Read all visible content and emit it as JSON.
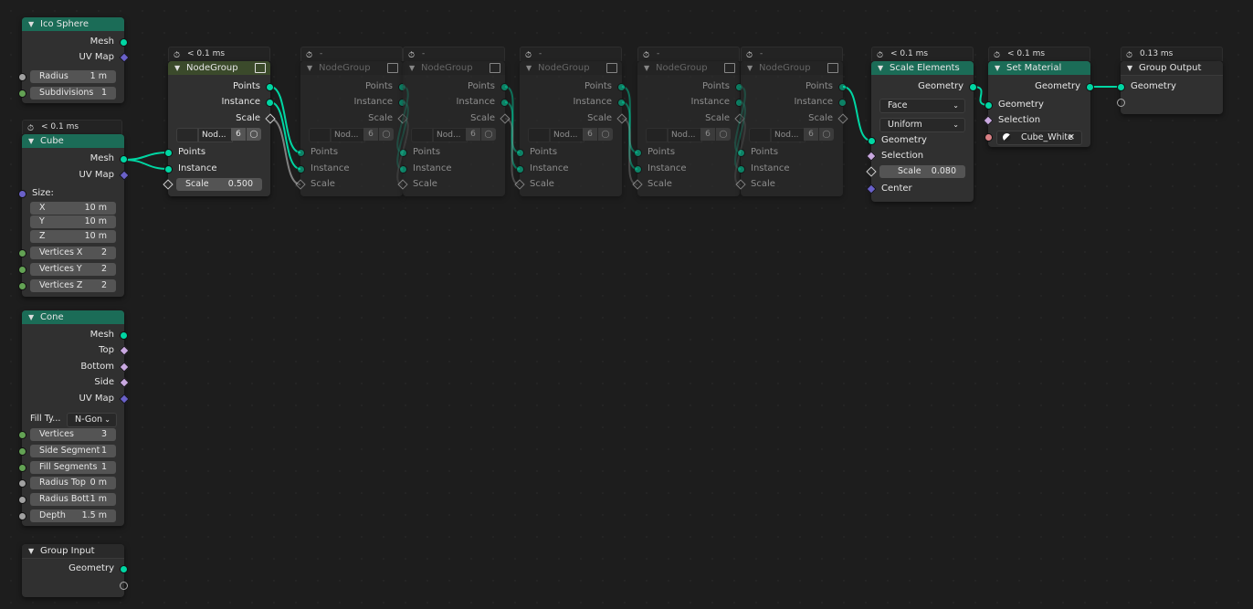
{
  "nodes": {
    "ico_sphere": {
      "title": "Ico Sphere",
      "outputs": [
        "Mesh",
        "UV Map"
      ],
      "fields": [
        {
          "label": "Radius",
          "value": "1 m"
        },
        {
          "label": "Subdivisions",
          "value": "1"
        }
      ]
    },
    "cube": {
      "timer": "< 0.1 ms",
      "title": "Cube",
      "outputs": [
        "Mesh",
        "UV Map"
      ],
      "size_label": "Size:",
      "fields": [
        {
          "label": "X",
          "value": "10 m"
        },
        {
          "label": "Y",
          "value": "10 m"
        },
        {
          "label": "Z",
          "value": "10 m"
        },
        {
          "label": "Vertices X",
          "value": "2"
        },
        {
          "label": "Vertices Y",
          "value": "2"
        },
        {
          "label": "Vertices Z",
          "value": "2"
        }
      ]
    },
    "cone": {
      "title": "Cone",
      "outputs": [
        "Mesh",
        "Top",
        "Bottom",
        "Side",
        "UV Map"
      ],
      "fill_type_label": "Fill Ty...",
      "fill_type_value": "N-Gon",
      "fields": [
        {
          "label": "Vertices",
          "value": "3"
        },
        {
          "label": "Side Segment",
          "value": "1"
        },
        {
          "label": "Fill Segments",
          "value": "1"
        },
        {
          "label": "Radius Top",
          "value": "0 m"
        },
        {
          "label": "Radius Bott",
          "value": "1 m"
        },
        {
          "label": "Depth",
          "value": "1.5 m"
        }
      ]
    },
    "group_input": {
      "title": "Group Input",
      "outputs": [
        "Geometry"
      ]
    },
    "node_groups": [
      {
        "timer": "< 0.1 ms",
        "title": "NodeGroup",
        "outputs": [
          "Points",
          "Instance",
          "Scale"
        ],
        "group_name": "Nod...",
        "users": "6",
        "inputs": [
          "Points",
          "Instance"
        ],
        "scale_label": "Scale",
        "scale_value": "0.500"
      },
      {
        "timer": "-",
        "title": "NodeGroup",
        "outputs": [
          "Points",
          "Instance",
          "Scale"
        ],
        "group_name": "Nod...",
        "users": "6",
        "inputs": [
          "Points",
          "Instance",
          "Scale"
        ]
      },
      {
        "timer": "-",
        "title": "NodeGroup",
        "outputs": [
          "Points",
          "Instance",
          "Scale"
        ],
        "group_name": "Nod...",
        "users": "6",
        "inputs": [
          "Points",
          "Instance",
          "Scale"
        ]
      },
      {
        "timer": "-",
        "title": "NodeGroup",
        "outputs": [
          "Points",
          "Instance",
          "Scale"
        ],
        "group_name": "Nod...",
        "users": "6",
        "inputs": [
          "Points",
          "Instance",
          "Scale"
        ]
      },
      {
        "timer": "-",
        "title": "NodeGroup",
        "outputs": [
          "Points",
          "Instance",
          "Scale"
        ],
        "group_name": "Nod...",
        "users": "6",
        "inputs": [
          "Points",
          "Instance",
          "Scale"
        ]
      },
      {
        "timer": "-",
        "title": "NodeGroup",
        "outputs": [
          "Points",
          "Instance",
          "Scale"
        ],
        "group_name": "Nod...",
        "users": "6",
        "inputs": [
          "Points",
          "Instance",
          "Scale"
        ]
      }
    ],
    "scale_elements": {
      "timer": "< 0.1 ms",
      "title": "Scale Elements",
      "output": "Geometry",
      "domain": "Face",
      "mode": "Uniform",
      "inputs": [
        "Geometry",
        "Selection"
      ],
      "scale_label": "Scale",
      "scale_value": "0.080",
      "center": "Center"
    },
    "set_material": {
      "timer": "< 0.1 ms",
      "title": "Set Material",
      "output": "Geometry",
      "inputs": [
        "Geometry",
        "Selection"
      ],
      "material": "Cube_White"
    },
    "group_output": {
      "timer": "0.13 ms",
      "title": "Group Output",
      "inputs": [
        "Geometry"
      ]
    }
  },
  "colors": {
    "geometry_socket": "#00d6a3",
    "vector_socket": "#6a61c9",
    "integer_socket": "#63a254",
    "float_socket": "#a1a1a1",
    "material_socket": "#d87f84",
    "geometry_header": "#1b6c57",
    "group_header": "#3b4a2b",
    "background": "#1d1d1d",
    "node_body": "#303030"
  }
}
